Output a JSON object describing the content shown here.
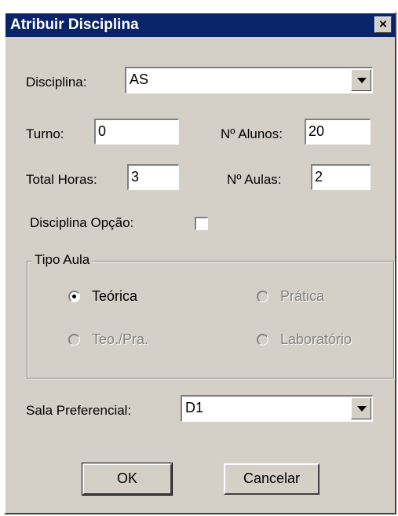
{
  "window": {
    "title": "Atribuir Disciplina",
    "close_icon": "×"
  },
  "form": {
    "disciplina": {
      "label": "Disciplina:",
      "value": "AS"
    },
    "turno": {
      "label": "Turno:",
      "value": "0"
    },
    "n_alunos": {
      "label": "Nº Alunos:",
      "value": "20"
    },
    "total_horas": {
      "label": "Total Horas:",
      "value": "3"
    },
    "n_aulas": {
      "label": "Nº Aulas:",
      "value": "2"
    },
    "disciplina_opcao": {
      "label": "Disciplina Opção:",
      "checked": false
    },
    "sala_preferencial": {
      "label": "Sala Preferencial:",
      "value": "D1"
    }
  },
  "tipo_aula": {
    "legend": "Tipo Aula",
    "options": [
      {
        "label": "Teórica",
        "selected": true,
        "enabled": true
      },
      {
        "label": "Prática",
        "selected": false,
        "enabled": false
      },
      {
        "label": "Teo./Pra.",
        "selected": false,
        "enabled": false
      },
      {
        "label": "Laboratório",
        "selected": false,
        "enabled": false
      }
    ]
  },
  "buttons": {
    "ok": "OK",
    "cancel": "Cancelar"
  }
}
